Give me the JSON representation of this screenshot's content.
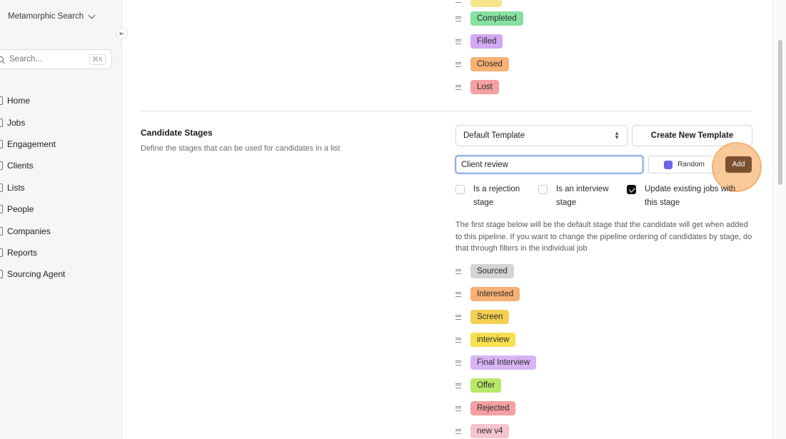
{
  "sidebar": {
    "workspace_name": "Metamorphic Search",
    "search_placeholder": "Search...",
    "search_shortcut": "⌘K",
    "items": [
      {
        "label": "Home"
      },
      {
        "label": "Jobs"
      },
      {
        "label": "Engagement"
      },
      {
        "label": "Clients"
      },
      {
        "label": "Lists"
      },
      {
        "label": "People"
      },
      {
        "label": "Companies"
      },
      {
        "label": "Reports"
      },
      {
        "label": "Sourcing Agent"
      }
    ]
  },
  "job_stages": [
    {
      "label": "Completed",
      "color": "#86e0a0"
    },
    {
      "label": "Filled",
      "color": "#d3a8f2"
    },
    {
      "label": "Closed",
      "color": "#f6b174"
    },
    {
      "label": "Lost",
      "color": "#f3a0a3"
    }
  ],
  "candidate_section": {
    "title": "Candidate Stages",
    "description": "Define the stages that can be used for candidates in a list",
    "template_select": "Default Template",
    "create_button": "Create New Template",
    "new_stage_value": "Client review",
    "random_button": "Random",
    "random_color": "#6c63e8",
    "add_button": "Add",
    "checkboxes": [
      {
        "label_line1": "Is a rejection",
        "label_line2": "stage",
        "checked": false
      },
      {
        "label_line1": "Is an interview",
        "label_line2": "stage",
        "checked": false
      },
      {
        "label_line1": "Update existing jobs with",
        "label_line2": "this stage",
        "checked": true
      }
    ],
    "info_text": "The first stage below will be the default stage that the candidate will get when added to this pipeline. If you want to change the pipeline ordering of candidates by stage, do that through filters in the individual job",
    "stages": [
      {
        "label": "Sourced",
        "color": "#d4d4d6"
      },
      {
        "label": "Interested",
        "color": "#f6b174"
      },
      {
        "label": "Screen",
        "color": "#f5cf52"
      },
      {
        "label": "interview",
        "color": "#f7df4e"
      },
      {
        "label": "Final Interview",
        "color": "#d7b4f5"
      },
      {
        "label": "Offer",
        "color": "#b7e86a"
      },
      {
        "label": "Rejected",
        "color": "#f3a0a3"
      },
      {
        "label": "new v4",
        "color": "#f6c4cf"
      }
    ]
  }
}
